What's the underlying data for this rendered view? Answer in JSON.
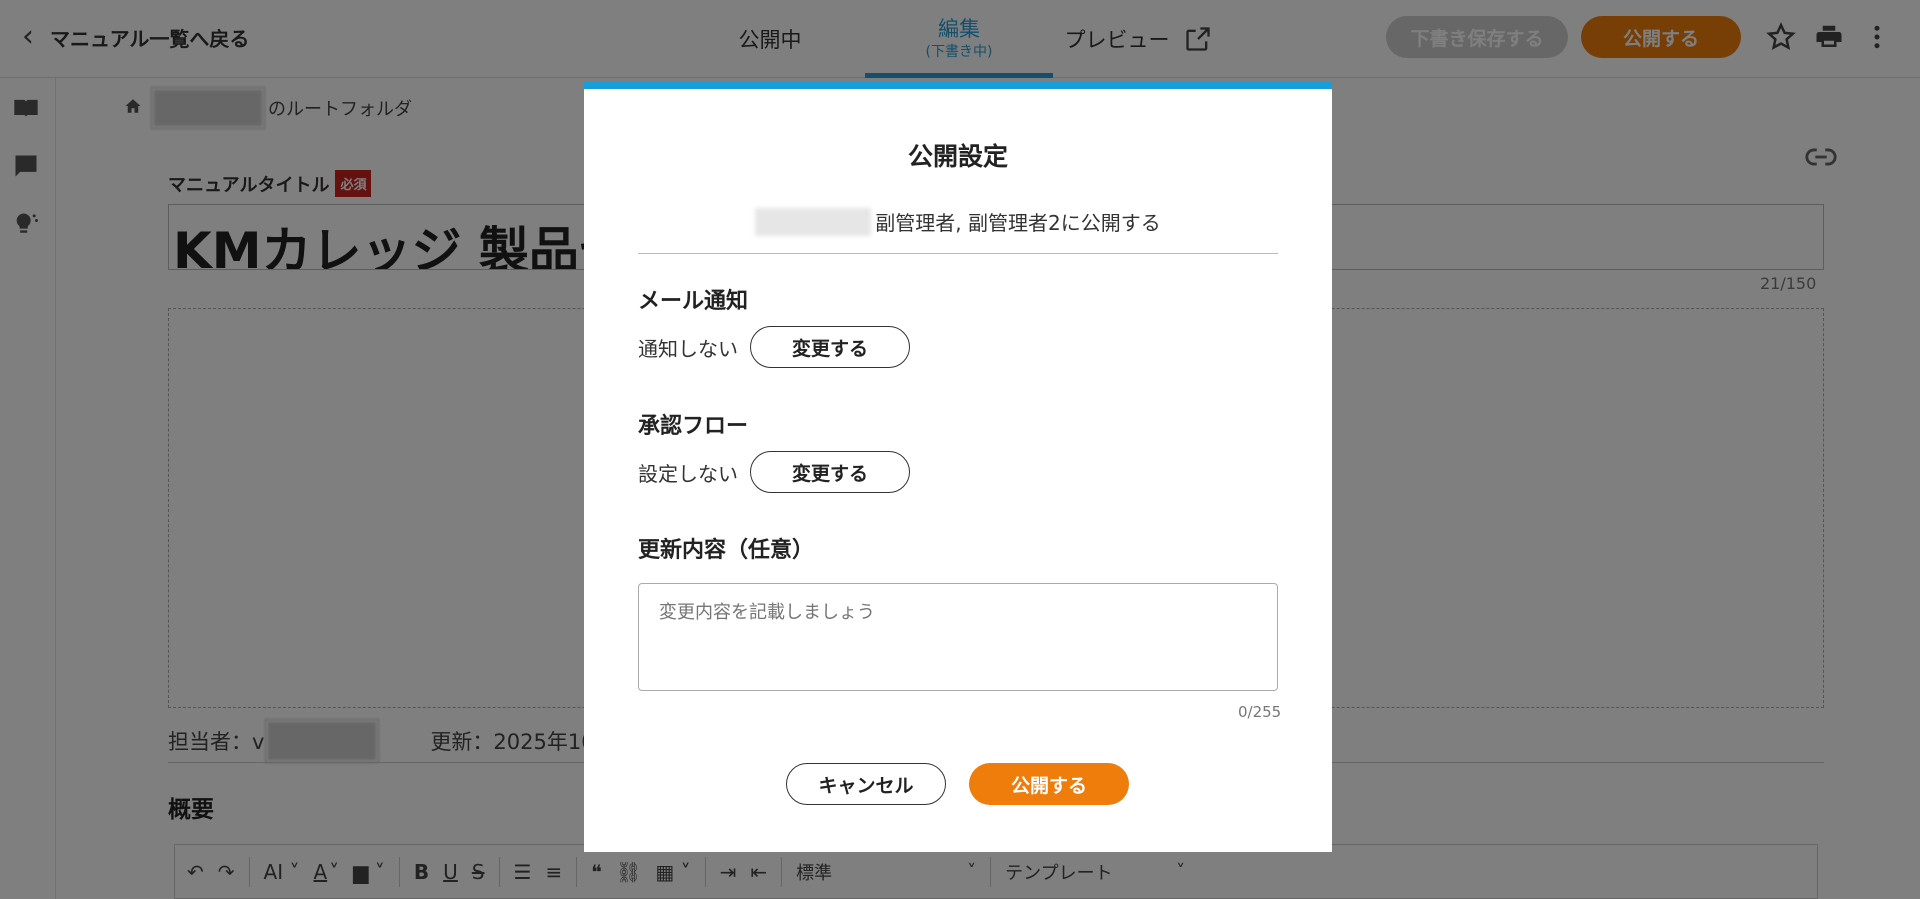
{
  "header": {
    "back_label": "マニュアル一覧へ戻る",
    "tabs": {
      "public": "公開中",
      "edit": "編集",
      "edit_sub": "(下書き中)",
      "preview": "プレビュー"
    },
    "draft_label": "下書き保存する",
    "publish_label": "公開する"
  },
  "breadcrumb": {
    "root_label": "のルートフォルダ"
  },
  "editor": {
    "title_label": "マニュアルタイトル",
    "required_badge": "必須",
    "title_value": "KMカレッジ 製品セ",
    "title_count": "21/150",
    "assignee_label": "担当者：v",
    "updated_label": "更新：2025年10",
    "summary_heading": "概要",
    "toolbar": {
      "style_select": "標準",
      "template_select": "テンプレート"
    }
  },
  "modal": {
    "title": "公開設定",
    "target_text": "副管理者, 副管理者2に公開する",
    "mail": {
      "heading": "メール通知",
      "value": "通知しない",
      "change_label": "変更する"
    },
    "flow": {
      "heading": "承認フロー",
      "value": "設定しない",
      "change_label": "変更する"
    },
    "update": {
      "heading": "更新内容（任意）",
      "placeholder": "変更内容を記載しましょう",
      "count": "0/255"
    },
    "cancel_label": "キャンセル",
    "publish_label": "公開する"
  },
  "colors": {
    "accent_blue": "#1a9edb",
    "publish_orange": "#ee7d0c",
    "required_red": "#c8231e"
  }
}
